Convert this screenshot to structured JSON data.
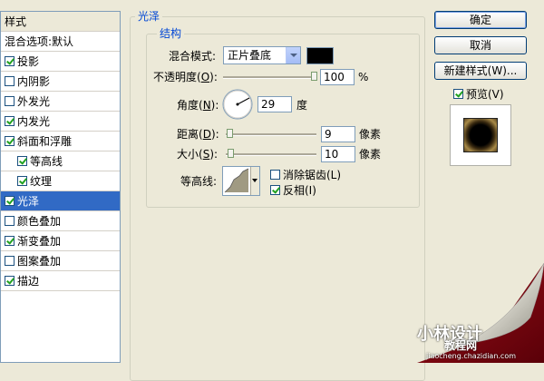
{
  "styles_panel": {
    "header": "样式",
    "items": [
      {
        "label": "混合选项:默认",
        "checkbox": false,
        "checked": false,
        "selected": false
      },
      {
        "label": "投影",
        "checkbox": true,
        "checked": true,
        "selected": false
      },
      {
        "label": "内阴影",
        "checkbox": true,
        "checked": false,
        "selected": false
      },
      {
        "label": "外发光",
        "checkbox": true,
        "checked": false,
        "selected": false
      },
      {
        "label": "内发光",
        "checkbox": true,
        "checked": true,
        "selected": false
      },
      {
        "label": "斜面和浮雕",
        "checkbox": true,
        "checked": true,
        "selected": false
      },
      {
        "label": "等高线",
        "checkbox": true,
        "checked": true,
        "selected": false,
        "sub": true
      },
      {
        "label": "纹理",
        "checkbox": true,
        "checked": true,
        "selected": false,
        "sub": true
      },
      {
        "label": "光泽",
        "checkbox": true,
        "checked": true,
        "selected": true
      },
      {
        "label": "颜色叠加",
        "checkbox": true,
        "checked": false,
        "selected": false
      },
      {
        "label": "渐变叠加",
        "checkbox": true,
        "checked": true,
        "selected": false
      },
      {
        "label": "图案叠加",
        "checkbox": true,
        "checked": false,
        "selected": false
      },
      {
        "label": "描边",
        "checkbox": true,
        "checked": true,
        "selected": false
      }
    ]
  },
  "satin": {
    "title": "光泽",
    "structure_title": "结构",
    "blend_mode_label": "混合模式:",
    "blend_mode_value": "正片叠底",
    "blend_color": "#000000",
    "opacity_label_pre": "不透明度(",
    "opacity_key": "O",
    "opacity_label_post": "):",
    "opacity_value": "100",
    "opacity_unit": "%",
    "angle_label_pre": "角度(",
    "angle_key": "N",
    "angle_label_post": "):",
    "angle_value": "29",
    "angle_unit": "度",
    "distance_label_pre": "距离(",
    "distance_key": "D",
    "distance_label_post": "):",
    "distance_value": "9",
    "distance_unit": "像素",
    "size_label_pre": "大小(",
    "size_key": "S",
    "size_label_post": "):",
    "size_value": "10",
    "size_unit": "像素",
    "contour_label": "等高线:",
    "antialias_label": "消除锯齿(L)",
    "antialias_checked": false,
    "invert_label": "反相(I)",
    "invert_checked": true
  },
  "buttons": {
    "ok": "确定",
    "cancel": "取消",
    "new_style": "新建样式(W)...",
    "preview_label": "预览(V)",
    "preview_checked": true
  },
  "watermark": {
    "brand": "小林设计",
    "site": "jiaocheng.chazidian.com",
    "tutorial": "教程网"
  }
}
